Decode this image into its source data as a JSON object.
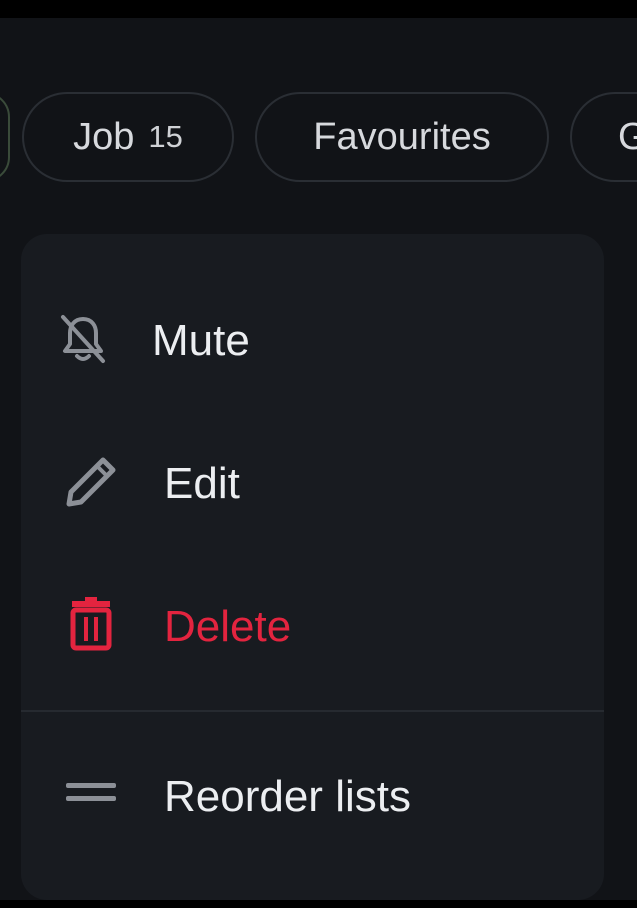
{
  "filters": {
    "chips": [
      {
        "label": "Job",
        "count": "15"
      },
      {
        "label": "Favourites"
      },
      {
        "label": "G"
      }
    ]
  },
  "menu": {
    "items": [
      {
        "label": "Mute",
        "icon": "bell-off-icon"
      },
      {
        "label": "Edit",
        "icon": "pencil-icon"
      },
      {
        "label": "Delete",
        "icon": "trash-icon"
      },
      {
        "label": "Reorder lists",
        "icon": "drag-handle-icon"
      }
    ]
  },
  "colors": {
    "background": "#111317",
    "menu_background": "#181b20",
    "chip_border": "#2a2e34",
    "danger": "#e3243f",
    "icon": "#8c9097"
  }
}
